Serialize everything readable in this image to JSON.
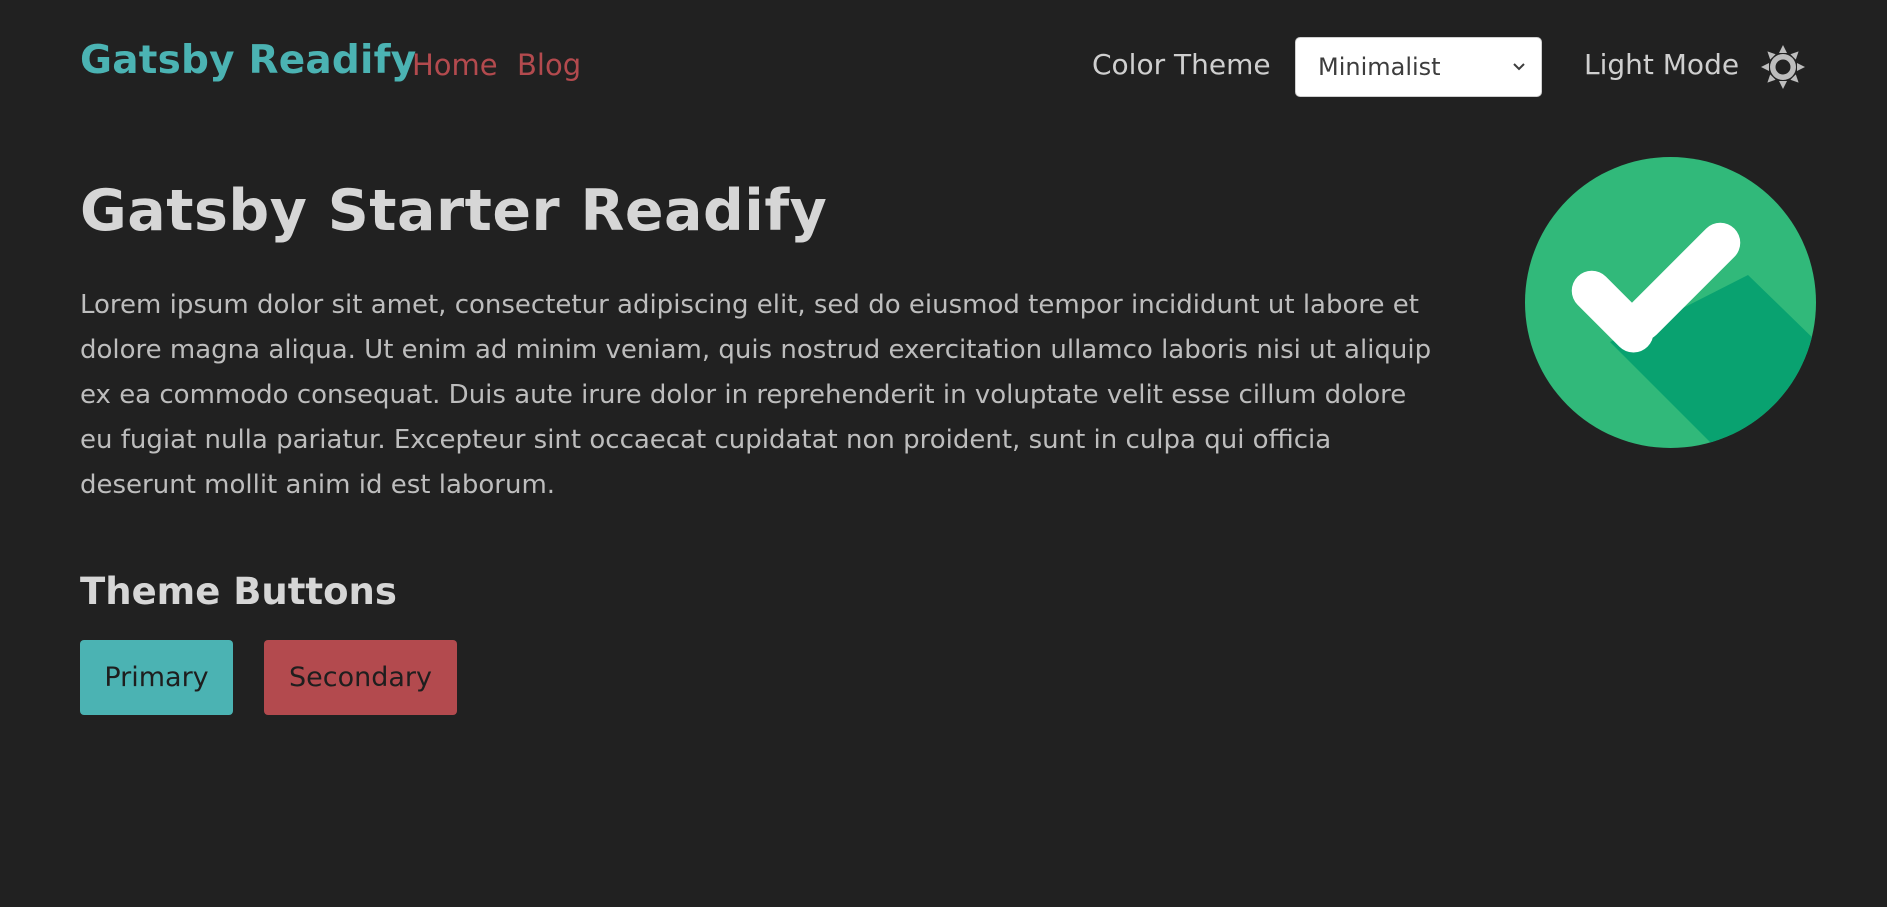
{
  "navbar": {
    "brand": "Gatsby Readify",
    "links": [
      "Home",
      "Blog"
    ],
    "color_theme_label": "Color Theme",
    "color_theme_selected": "Minimalist",
    "mode_label": "Light Mode",
    "mode_icon": "sun-icon"
  },
  "main": {
    "title": "Gatsby Starter Readify",
    "text": "Lorem ipsum dolor sit amet, consectetur adipiscing elit, sed do eiusmod tempor incididunt ut labore et dolore magna aliqua. Ut enim ad minim veniam, quis nostrud exercitation ullamco laboris nisi ut aliquip ex ea commodo consequat. Duis aute irure dolor in reprehenderit in voluptate velit esse cillum dolore eu fugiat nulla pariatur. Excepteur sint occaecat cupidatat non proident, sunt in culpa qui officia deserunt mollit anim id est laborum.",
    "image_icon": "checkmark-icon",
    "section_title": "Theme Buttons",
    "buttons": [
      "Primary",
      "Secondary"
    ]
  },
  "colors": {
    "background": "#212121",
    "primary": "#4bb3b3",
    "secondary": "#b34a4e",
    "check_green": "#31b97a",
    "check_shadow": "#09a270"
  }
}
